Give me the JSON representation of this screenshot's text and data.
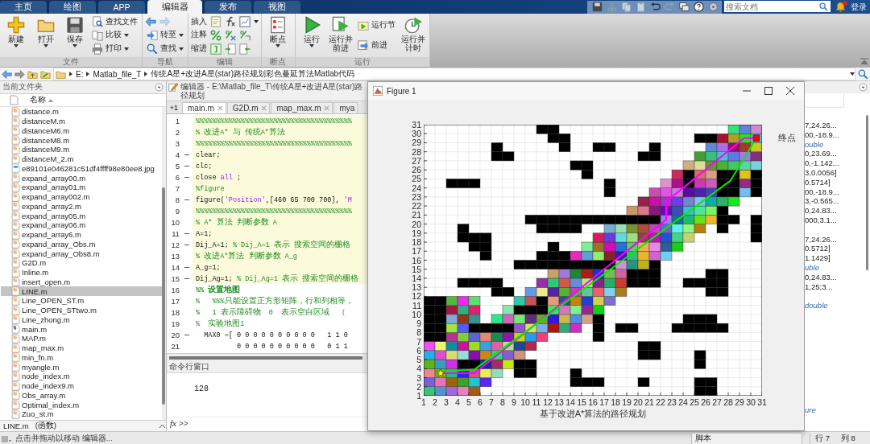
{
  "tabs": [
    {
      "label": "主页",
      "selected": false
    },
    {
      "label": "绘图",
      "selected": false
    },
    {
      "label": "APP",
      "selected": false
    },
    {
      "label": "编辑器",
      "selected": true
    },
    {
      "label": "发布",
      "selected": false
    },
    {
      "label": "视图",
      "selected": false
    }
  ],
  "search": {
    "placeholder": "搜索文档"
  },
  "notification": {
    "unread": true
  },
  "login": "登录",
  "ribbon": [
    {
      "label": "文件",
      "items": [
        {
          "kind": "large",
          "label": "新建",
          "dropdown": true
        },
        {
          "kind": "large",
          "label": "打开",
          "dropdown": true
        },
        {
          "kind": "large",
          "label": "保存",
          "dropdown": true
        },
        {
          "kind": "stack",
          "rows": [
            {
              "kind": "small",
              "label": "查找文件",
              "dropdown": false
            },
            {
              "kind": "small",
              "label": "比较",
              "dropdown": true
            },
            {
              "kind": "small",
              "label": "打印",
              "dropdown": true
            }
          ]
        }
      ]
    },
    {
      "label": "导航",
      "items": [
        {
          "kind": "stack",
          "rows": [
            {
              "kind": "arrows",
              "forward_enabled": false
            },
            {
              "kind": "small",
              "label": "转至",
              "dropdown": true
            },
            {
              "kind": "small",
              "label": "查找",
              "dropdown": true
            }
          ]
        }
      ]
    },
    {
      "label": "编辑",
      "items": [
        {
          "kind": "stack",
          "rows": [
            {
              "kind": "tools",
              "label": "插入",
              "dropdown": true
            },
            {
              "kind": "tools",
              "label": "注释",
              "dropdown": false
            },
            {
              "kind": "tools",
              "label": "缩进",
              "dropdown": false
            }
          ]
        }
      ]
    },
    {
      "label": "断点",
      "items": [
        {
          "kind": "large",
          "label": "断点",
          "dropdown": true
        }
      ]
    },
    {
      "label": "运行",
      "items": [
        {
          "kind": "large",
          "label": "运行",
          "dropdown": true
        },
        {
          "kind": "large",
          "label": "运行并前进",
          "dropdown": false
        },
        {
          "kind": "stack",
          "rows": [
            {
              "kind": "small",
              "label": "运行节",
              "dropdown": false
            },
            {
              "kind": "small",
              "label": "前进",
              "dropdown": false
            }
          ]
        },
        {
          "kind": "large",
          "label": "运行并计时",
          "dropdown": false
        }
      ]
    }
  ],
  "address": {
    "path": [
      "E:",
      "Matlab_file_T",
      "传统A星+改进A星(star)路径规划彩色蔓延算法Matlab代码"
    ]
  },
  "files": {
    "title": "当前文件夹",
    "column": "名称",
    "items": [
      {
        "name": "distance.m",
        "kind": "function",
        "selected": false
      },
      {
        "name": "distanceM.m",
        "kind": "function",
        "selected": false
      },
      {
        "name": "distanceM6.m",
        "kind": "function",
        "selected": false
      },
      {
        "name": "distanceM8.m",
        "kind": "function",
        "selected": false
      },
      {
        "name": "distanceM9.m",
        "kind": "function",
        "selected": false
      },
      {
        "name": "distanceM_2.m",
        "kind": "function",
        "selected": false
      },
      {
        "name": "e89101e046281c51df4ffff98e80ee8.jpg",
        "kind": "image",
        "selected": false
      },
      {
        "name": "expand_array00.m",
        "kind": "function",
        "selected": false
      },
      {
        "name": "expand_array01.m",
        "kind": "function",
        "selected": false
      },
      {
        "name": "expand_array002.m",
        "kind": "function",
        "selected": false
      },
      {
        "name": "expand_array2.m",
        "kind": "function",
        "selected": false
      },
      {
        "name": "expand_array05.m",
        "kind": "function",
        "selected": false
      },
      {
        "name": "expand_array06.m",
        "kind": "function",
        "selected": false
      },
      {
        "name": "expand_array6.m",
        "kind": "function",
        "selected": false
      },
      {
        "name": "expand_array_Obs.m",
        "kind": "function",
        "selected": false
      },
      {
        "name": "expand_array_Obs8.m",
        "kind": "function",
        "selected": false
      },
      {
        "name": "G2D.m",
        "kind": "function",
        "selected": false
      },
      {
        "name": "Inline.m",
        "kind": "function",
        "selected": false
      },
      {
        "name": "insert_open.m",
        "kind": "function",
        "selected": false
      },
      {
        "name": "LINE.m",
        "kind": "function",
        "selected": true
      },
      {
        "name": "Line_OPEN_ST.m",
        "kind": "function",
        "selected": false
      },
      {
        "name": "Line_OPEN_STtwo.m",
        "kind": "function",
        "selected": false
      },
      {
        "name": "Line_zhong.m",
        "kind": "function",
        "selected": false
      },
      {
        "name": "main.m",
        "kind": "script",
        "selected": false
      },
      {
        "name": "MAP.m",
        "kind": "function",
        "selected": false
      },
      {
        "name": "map_max.m",
        "kind": "function",
        "selected": false
      },
      {
        "name": "min_fn.m",
        "kind": "function",
        "selected": false
      },
      {
        "name": "myangle.m",
        "kind": "function",
        "selected": false
      },
      {
        "name": "node_index.m",
        "kind": "function",
        "selected": false
      },
      {
        "name": "node_index9.m",
        "kind": "function",
        "selected": false
      },
      {
        "name": "Obs_array.m",
        "kind": "function",
        "selected": false
      },
      {
        "name": "Optimal_index.m",
        "kind": "function",
        "selected": false
      },
      {
        "name": "Zuo_st.m",
        "kind": "function",
        "selected": false
      }
    ],
    "details": {
      "name": "LINE.m",
      "type": "(函数)"
    }
  },
  "editor": {
    "title": "编辑器 - E:\\Matlab_file_T\\传统A星+改进A星(star)路径规划",
    "cell_marker": "+1",
    "tabs": [
      {
        "label": "main.m",
        "selected": true,
        "closable": true
      },
      {
        "label": "G2D.m",
        "selected": false,
        "closable": true
      },
      {
        "label": "map_max.m",
        "selected": false,
        "closable": true
      },
      {
        "label": "mya",
        "selected": false,
        "closable": false
      }
    ],
    "lines": [
      {
        "number": "1",
        "executable": false,
        "in_cell": true,
        "segments": [
          {
            "kind": "comment",
            "text": "%%%%%%%%%%%%%%%%%%%%%%%%%%%%%%%%%%%%%%"
          }
        ]
      },
      {
        "number": "2",
        "executable": false,
        "in_cell": true,
        "segments": [
          {
            "kind": "comment",
            "text": "% 改进A* 与 传统A*算法"
          }
        ]
      },
      {
        "number": "3",
        "executable": false,
        "in_cell": true,
        "segments": [
          {
            "kind": "comment",
            "text": "%%%%%%%%%%%%%%%%%%%%%%%%%%%%%%%%%%%%%%"
          }
        ]
      },
      {
        "number": "4",
        "executable": true,
        "in_cell": true,
        "segments": [
          {
            "kind": "code",
            "text": "clear;"
          }
        ]
      },
      {
        "number": "5",
        "executable": true,
        "in_cell": true,
        "segments": [
          {
            "kind": "code",
            "text": "clc;"
          }
        ]
      },
      {
        "number": "6",
        "executable": true,
        "in_cell": true,
        "segments": [
          {
            "kind": "code",
            "text": "close "
          },
          {
            "kind": "keyword",
            "text": "all"
          },
          {
            "kind": "code",
            "text": " ;"
          }
        ]
      },
      {
        "number": "7",
        "executable": false,
        "in_cell": true,
        "segments": [
          {
            "kind": "comment",
            "text": "%figure"
          }
        ]
      },
      {
        "number": "8",
        "executable": true,
        "in_cell": true,
        "segments": [
          {
            "kind": "code",
            "text": "figure("
          },
          {
            "kind": "string",
            "text": "'Position'"
          },
          {
            "kind": "code",
            "text": ",[460 65 700 700], "
          },
          {
            "kind": "string",
            "text": "'M"
          }
        ]
      },
      {
        "number": "9",
        "executable": false,
        "in_cell": true,
        "segments": [
          {
            "kind": "comment",
            "text": "%%%%%%%%%%%%%%%%%%%%%%%%%%%%%%%%%%%%%%"
          }
        ]
      },
      {
        "number": "10",
        "executable": false,
        "in_cell": true,
        "segments": [
          {
            "kind": "comment",
            "text": "% A* 算法 判断参数 A"
          }
        ]
      },
      {
        "number": "11",
        "executable": true,
        "in_cell": true,
        "segments": [
          {
            "kind": "code",
            "text": "A=1;"
          }
        ]
      },
      {
        "number": "12",
        "executable": true,
        "in_cell": true,
        "segments": [
          {
            "kind": "code",
            "text": "Dij_A=1; "
          },
          {
            "kind": "comment",
            "text": "% Dij_A=1 表示 搜索空间的栅格"
          }
        ]
      },
      {
        "number": "13",
        "executable": false,
        "in_cell": true,
        "segments": [
          {
            "kind": "comment",
            "text": "% 改进A*算法 判断参数 A_g"
          }
        ]
      },
      {
        "number": "14",
        "executable": true,
        "in_cell": true,
        "segments": [
          {
            "kind": "code",
            "text": "A_g=1;"
          }
        ]
      },
      {
        "number": "15",
        "executable": true,
        "in_cell": true,
        "segments": [
          {
            "kind": "code",
            "text": "Dij_Ag=1; "
          },
          {
            "kind": "comment",
            "text": "% Dij_Ag=1 表示 搜索空间的栅格"
          }
        ]
      },
      {
        "number": "16",
        "executable": false,
        "in_cell": false,
        "segments": [
          {
            "kind": "section",
            "text": "%% 设置地图"
          }
        ]
      },
      {
        "number": "17",
        "executable": false,
        "in_cell": false,
        "segments": [
          {
            "kind": "comment",
            "text": "%   %%%只能设置正方形矩阵，行和列相等，"
          }
        ]
      },
      {
        "number": "18",
        "executable": false,
        "in_cell": false,
        "segments": [
          {
            "kind": "comment",
            "text": "%   1 表示障碍物  0  表示空白区域  （"
          }
        ]
      },
      {
        "number": "19",
        "executable": false,
        "in_cell": false,
        "segments": [
          {
            "kind": "comment",
            "text": "%  实验地图1"
          }
        ]
      },
      {
        "number": "20",
        "executable": true,
        "in_cell": false,
        "segments": [
          {
            "kind": "code",
            "text": "  MAX0 =[ 0 0 0 0 0 0 0 0 0 0   1 1 0"
          }
        ]
      },
      {
        "number": "21",
        "executable": false,
        "in_cell": false,
        "segments": [
          {
            "kind": "code",
            "text": "          0 0 0 0 0 0 0 0 0 0   0 1 1"
          }
        ]
      }
    ]
  },
  "command_window": {
    "title": "命令行窗口",
    "output": "128",
    "fx": "fx",
    "prompt": ">>"
  },
  "figure": {
    "title": "Figure 1",
    "plot": {
      "yticks": [
        "31",
        "30",
        "29",
        "28",
        "27",
        "26",
        "25",
        "24",
        "23",
        "22",
        "21",
        "20",
        "19",
        "18",
        "17",
        "16",
        "15",
        "14",
        "13",
        "12",
        "11",
        "10",
        "9",
        "8",
        "7",
        "6",
        "5",
        "4",
        "3",
        "2",
        "1"
      ],
      "xticks": [
        "1",
        "2",
        "3",
        "4",
        "5",
        "6",
        "7",
        "8",
        "9",
        "10",
        "11",
        "12",
        "13",
        "14",
        "15",
        "16",
        "17",
        "18",
        "19",
        "20",
        "21",
        "22",
        "23",
        "24",
        "25",
        "26",
        "27",
        "28",
        "29",
        "30",
        "31"
      ],
      "xlabel": "基于改进A*算法的路径规划",
      "end_label": "终点"
    }
  },
  "workspace": {
    "lines": [
      {
        "kind": "value",
        "text": "7,24.26..."
      },
      {
        "kind": "value",
        "text": "00,-18.9..."
      },
      {
        "kind": "type",
        "text": "ouble"
      },
      {
        "kind": "value",
        "text": "0,23.69..."
      },
      {
        "kind": "value",
        "text": "0,-1.142..."
      },
      {
        "kind": "value",
        "text": "3,0.0056]"
      },
      {
        "kind": "value",
        "text": "0.5714]"
      },
      {
        "kind": "value",
        "text": "00,-18.9..."
      },
      {
        "kind": "value",
        "text": "3,-0.565..."
      },
      {
        "kind": "value",
        "text": "0,24.83..."
      },
      {
        "kind": "value",
        "text": "000,3.1..."
      },
      {
        "kind": "gap"
      },
      {
        "kind": "value",
        "text": "7,24.26..."
      },
      {
        "kind": "value",
        "text": "0.5712]"
      },
      {
        "kind": "value",
        "text": "1.1429]"
      },
      {
        "kind": "type",
        "text": "uble"
      },
      {
        "kind": "value",
        "text": "0,24.83..."
      },
      {
        "kind": "value",
        "text": "1,25;3..."
      },
      {
        "kind": "gap"
      },
      {
        "kind": "type",
        "text": "double"
      },
      {
        "kind": "gap"
      },
      {
        "kind": "gap"
      },
      {
        "kind": "gap"
      },
      {
        "kind": "gap"
      },
      {
        "kind": "gap"
      },
      {
        "kind": "gap"
      },
      {
        "kind": "gap"
      },
      {
        "kind": "gap"
      },
      {
        "kind": "gap"
      },
      {
        "kind": "gap"
      },
      {
        "kind": "type",
        "text": "ure"
      }
    ]
  },
  "status_bar": {
    "message": "点击并拖动以移动 编辑器...",
    "file_type": "脚本",
    "line": "行 7",
    "column": "列 8"
  }
}
